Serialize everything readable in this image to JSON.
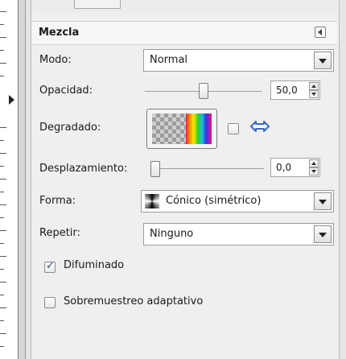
{
  "panel": {
    "title": "Mezcla"
  },
  "fields": {
    "mode": {
      "label": "Modo:",
      "value": "Normal"
    },
    "opacity": {
      "label": "Opacidad:",
      "value": "50,0",
      "fraction": 0.5
    },
    "gradient": {
      "label": "Degradado:",
      "reverse_checked": false
    },
    "offset": {
      "label": "Desplazamiento:",
      "value": "0,0",
      "fraction": 0.0
    },
    "shape": {
      "label": "Forma:",
      "value": "Cónico (simétrico)"
    },
    "repeat": {
      "label": "Repetir:",
      "value": "Ninguno"
    }
  },
  "options": {
    "dither": {
      "label": "Difuminado",
      "checked": true
    },
    "adaptive": {
      "label": "Sobremuestreo adaptativo",
      "checked": false
    }
  },
  "icons": {
    "panel_menu": "panel-menu-icon",
    "swap": "swap-arrows-icon",
    "shape": "conical-shape-icon"
  },
  "colors": {
    "swap_icon": "#3b66c9"
  }
}
